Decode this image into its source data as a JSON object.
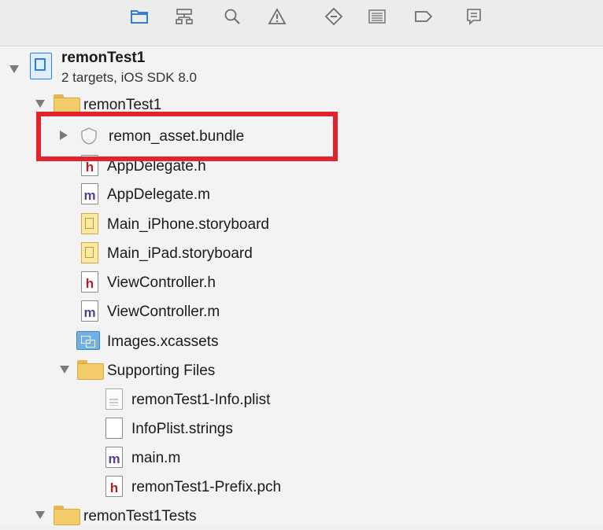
{
  "toolbar": {
    "icons": [
      "project-navigator-icon",
      "symbol-navigator-icon",
      "find-navigator-icon",
      "issue-navigator-icon",
      "test-navigator-icon",
      "debug-navigator-icon",
      "breakpoint-navigator-icon",
      "report-navigator-icon"
    ]
  },
  "tree": {
    "project": {
      "name": "remonTest1",
      "subtitle": "2 targets, iOS SDK 8.0"
    },
    "group_main": "remonTest1",
    "bundle": "remon_asset.bundle",
    "files": {
      "appdelegate_h": "AppDelegate.h",
      "appdelegate_m": "AppDelegate.m",
      "main_iphone": "Main_iPhone.storyboard",
      "main_ipad": "Main_iPad.storyboard",
      "viewcontroller_h": "ViewController.h",
      "viewcontroller_m": "ViewController.m",
      "images": "Images.xcassets"
    },
    "supporting": {
      "label": "Supporting Files",
      "info_plist": "remonTest1-Info.plist",
      "infoplist_strings": "InfoPlist.strings",
      "main_m": "main.m",
      "prefix_pch": "remonTest1-Prefix.pch"
    },
    "group_tests": "remonTest1Tests"
  },
  "glyphs": {
    "h": "h",
    "m": "m"
  },
  "colors": {
    "highlight": "#e3232c",
    "accent": "#2f7fd6"
  }
}
